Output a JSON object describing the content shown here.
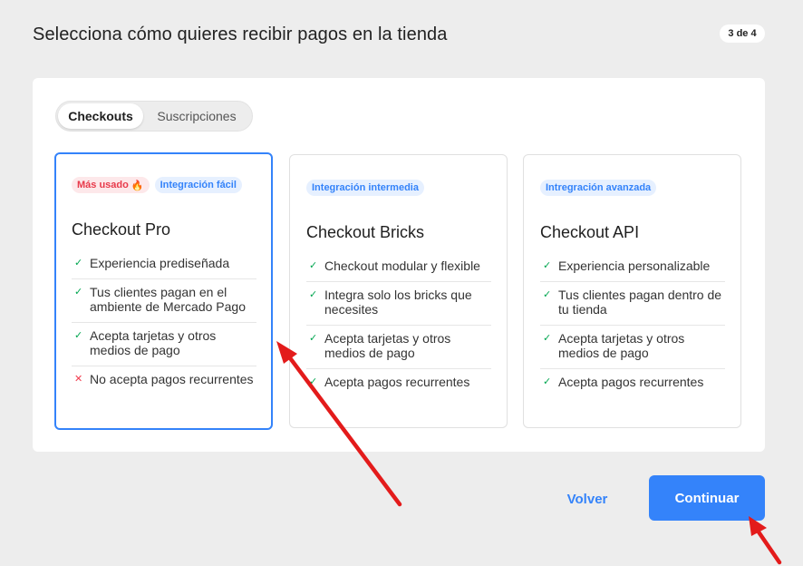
{
  "header": {
    "title": "Selecciona cómo quieres recibir pagos en la tienda",
    "step": "3 de 4"
  },
  "tabs": [
    {
      "label": "Checkouts",
      "active": true
    },
    {
      "label": "Suscripciones",
      "active": false
    }
  ],
  "cards": [
    {
      "title": "Checkout Pro",
      "selected": true,
      "tags": [
        {
          "label": "Más usado",
          "style": "red",
          "icon": "flame-icon"
        },
        {
          "label": "Integración fácil",
          "style": "blue"
        }
      ],
      "features": [
        {
          "text": "Experiencia prediseñada",
          "ok": true
        },
        {
          "text": "Tus clientes pagan en el ambiente de Mercado Pago",
          "ok": true
        },
        {
          "text": "Acepta tarjetas y otros medios de pago",
          "ok": true
        },
        {
          "text": "No acepta pagos recurrentes",
          "ok": false
        }
      ]
    },
    {
      "title": "Checkout Bricks",
      "selected": false,
      "tags": [
        {
          "label": "Integración intermedia",
          "style": "blue"
        }
      ],
      "features": [
        {
          "text": "Checkout modular y flexible",
          "ok": true
        },
        {
          "text": "Integra solo los bricks que necesites",
          "ok": true
        },
        {
          "text": "Acepta tarjetas y otros medios de pago",
          "ok": true
        },
        {
          "text": "Acepta pagos recurrentes",
          "ok": true
        }
      ]
    },
    {
      "title": "Checkout API",
      "selected": false,
      "tags": [
        {
          "label": "Intregración avanzada",
          "style": "blue"
        }
      ],
      "features": [
        {
          "text": "Experiencia personalizable",
          "ok": true
        },
        {
          "text": "Tus clientes pagan dentro de tu tienda",
          "ok": true
        },
        {
          "text": "Acepta tarjetas y otros medios de pago",
          "ok": true
        },
        {
          "text": "Acepta pagos recurrentes",
          "ok": true
        }
      ]
    }
  ],
  "footer": {
    "back_label": "Volver",
    "continue_label": "Continuar"
  },
  "icons": {
    "check": "✓",
    "cross": "✕",
    "flame": "🔥"
  },
  "colors": {
    "accent": "#3483fa",
    "check": "#00a650",
    "cross": "#f23d4f",
    "annotation_arrow": "#e31b1b"
  }
}
